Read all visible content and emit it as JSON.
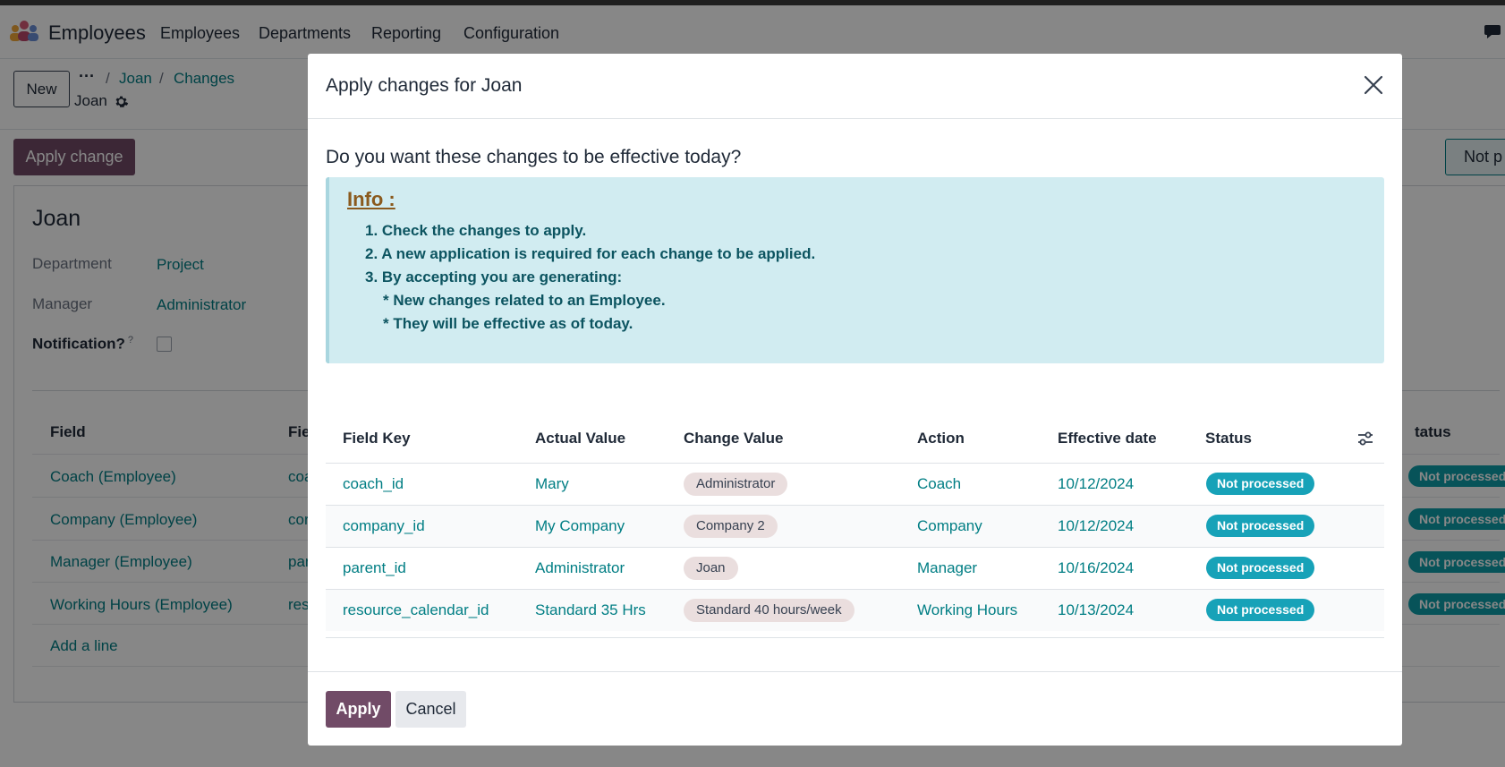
{
  "navbar": {
    "app_name": "Employees",
    "menu": [
      "Employees",
      "Departments",
      "Reporting",
      "Configuration"
    ]
  },
  "control_panel": {
    "new_label": "New",
    "breadcrumb": [
      "Joan",
      "Changes"
    ],
    "record_name": "Joan",
    "apply_change_label": "Apply change",
    "status_button_label": "Not p"
  },
  "sheet": {
    "title": "Joan",
    "department_label": "Department",
    "department_value": "Project",
    "manager_label": "Manager",
    "manager_value": "Administrator",
    "notification_label": "Notification?",
    "notification_help": "?",
    "columns": [
      "Field",
      "Fie",
      "tatus"
    ],
    "rows": [
      {
        "field": "Coach (Employee)",
        "key": "coa",
        "status": "Not processed"
      },
      {
        "field": "Company (Employee)",
        "key": "cor",
        "status": "Not processed"
      },
      {
        "field": "Manager (Employee)",
        "key": "par",
        "status": "Not processed"
      },
      {
        "field": "Working Hours (Employee)",
        "key": "res",
        "status": "Not processed"
      }
    ],
    "add_line": "Add a line"
  },
  "modal": {
    "title": "Apply changes for Joan",
    "question": "Do you want these changes to be effective today?",
    "info_title": "Info :",
    "info_lines": [
      "1. Check the changes to apply.",
      "2. A new application is required for each change to be applied.",
      "3. By accepting you are generating:",
      "* New changes related to an Employee.",
      "* They will be effective as of today."
    ],
    "columns": [
      "Field Key",
      "Actual Value",
      "Change Value",
      "Action",
      "Effective date",
      "Status"
    ],
    "rows": [
      {
        "key": "coach_id",
        "actual": "Mary",
        "change": "Administrator",
        "action": "Coach",
        "date": "10/12/2024",
        "status": "Not processed"
      },
      {
        "key": "company_id",
        "actual": "My Company",
        "change": "Company 2",
        "action": "Company",
        "date": "10/12/2024",
        "status": "Not processed"
      },
      {
        "key": "parent_id",
        "actual": "Administrator",
        "change": "Joan",
        "action": "Manager",
        "date": "10/16/2024",
        "status": "Not processed"
      },
      {
        "key": "resource_calendar_id",
        "actual": "Standard 35 Hrs",
        "change": "Standard 40 hours/week",
        "action": "Working Hours",
        "date": "10/13/2024",
        "status": "Not processed"
      }
    ],
    "apply_label": "Apply",
    "cancel_label": "Cancel"
  },
  "colors": {
    "brand": "#714b67",
    "link": "#017e84",
    "badge": "#17a2b8",
    "info_bg": "#d1ecf1"
  }
}
